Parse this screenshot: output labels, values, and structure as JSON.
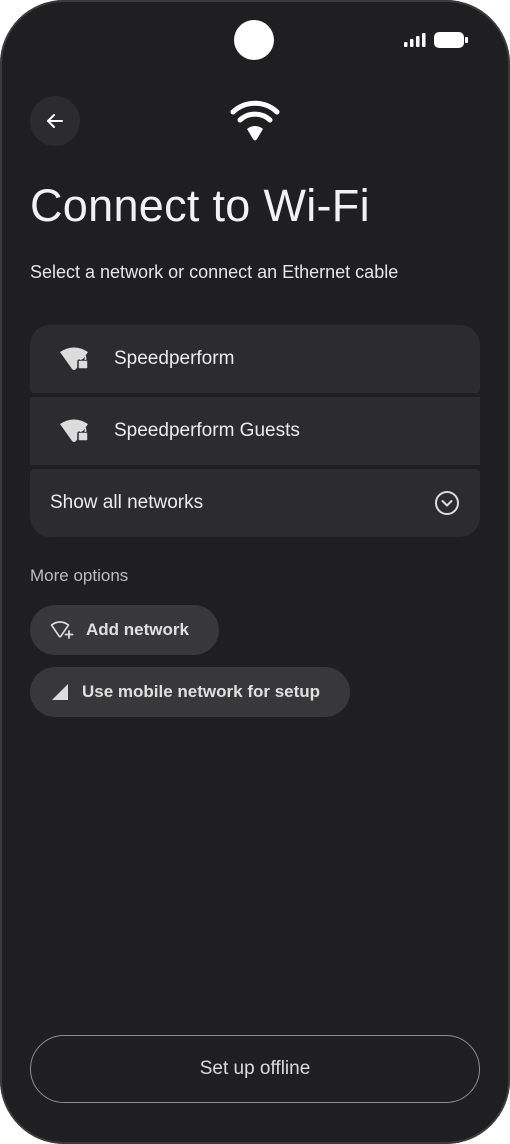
{
  "status_bar": {
    "signal_icon": "cellular-signal-icon",
    "battery_icon": "battery-icon"
  },
  "header": {
    "back_icon": "arrow-left-icon",
    "hero_icon": "wifi-icon"
  },
  "page": {
    "title": "Connect to Wi-Fi",
    "subtitle": "Select a network or connect an Ethernet cable"
  },
  "networks": [
    {
      "label": "Speedperform",
      "icon": "wifi-lock-icon"
    },
    {
      "label": "Speedperform Guests",
      "icon": "wifi-lock-icon"
    }
  ],
  "show_all": {
    "label": "Show all networks",
    "icon": "chevron-down-circle-icon"
  },
  "more_options": {
    "heading": "More options",
    "add_network": {
      "label": "Add network",
      "icon": "wifi-add-icon"
    },
    "mobile_setup": {
      "label": "Use mobile network for setup",
      "icon": "cellular-icon"
    }
  },
  "footer": {
    "offline_label": "Set up offline"
  },
  "colors": {
    "background": "#1f1f21",
    "surface": "#2c2c2e",
    "chip": "#38383a",
    "text": "#f2f2f2"
  }
}
